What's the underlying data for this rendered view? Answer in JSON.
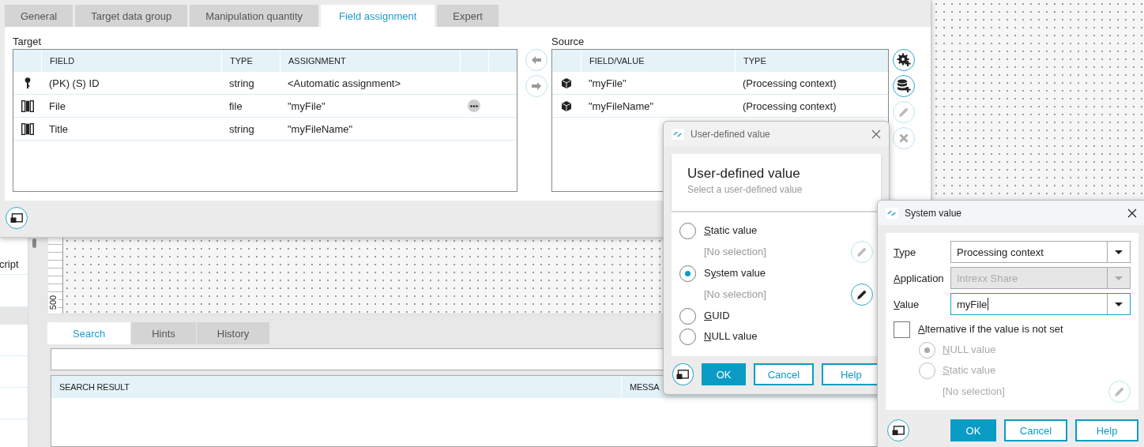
{
  "background": {
    "sidebar_items": [
      {
        "label": "cript"
      }
    ],
    "ruler_label": "500",
    "tabs": [
      {
        "label": "Search",
        "selected": true
      },
      {
        "label": "Hints",
        "selected": false
      },
      {
        "label": "History",
        "selected": false
      }
    ],
    "result_columns": [
      "SEARCH RESULT",
      "MESSA"
    ]
  },
  "window": {
    "tabs": [
      {
        "label": "General",
        "selected": false
      },
      {
        "label": "Target data group",
        "selected": false
      },
      {
        "label": "Manipulation quantity",
        "selected": false
      },
      {
        "label": "Field assignment",
        "selected": true
      },
      {
        "label": "Expert",
        "selected": false
      }
    ],
    "target": {
      "title": "Target",
      "columns": [
        "FIELD",
        "TYPE",
        "ASSIGNMENT"
      ],
      "rows": [
        {
          "kind": "key",
          "field": "(PK) (S) ID",
          "type": "string",
          "assignment": "<Automatic assignment>",
          "has_options": false
        },
        {
          "kind": "field",
          "field": "File",
          "type": "file",
          "assignment": "\"myFile\"",
          "has_options": true
        },
        {
          "kind": "field",
          "field": "Title",
          "type": "string",
          "assignment": "\"myFileName\"",
          "has_options": false
        }
      ]
    },
    "transfer_buttons": [
      {
        "kind": "left",
        "disabled": true
      },
      {
        "kind": "right",
        "disabled": true
      }
    ],
    "source": {
      "title": "Source",
      "columns": [
        "FIELD/VALUE",
        "TYPE"
      ],
      "rows": [
        {
          "value": "\"myFile\"",
          "type": "(Processing context)"
        },
        {
          "value": "\"myFileName\"",
          "type": "(Processing context)"
        }
      ]
    },
    "actions": [
      {
        "kind": "add-gear",
        "disabled": false
      },
      {
        "kind": "add-database",
        "disabled": false
      },
      {
        "kind": "edit",
        "disabled": true
      },
      {
        "kind": "delete",
        "disabled": true
      }
    ]
  },
  "user_defined_dialog": {
    "title": "User-defined value",
    "heading": "User-defined value",
    "subtitle": "Select a user-defined value",
    "options": [
      {
        "label": {
          "key": "S",
          "after": "tatic value"
        },
        "selected": false,
        "value": "[No selection]",
        "edit_disabled": true
      },
      {
        "label": {
          "before": "S",
          "key": "y",
          "after": "stem value"
        },
        "selected": true,
        "value": "[No selection]",
        "edit_disabled": false
      },
      {
        "label": {
          "key": "G",
          "after": "UID"
        },
        "selected": false
      },
      {
        "label": {
          "key": "N",
          "after": "ULL value"
        },
        "selected": false
      }
    ],
    "buttons": [
      {
        "label": "OK",
        "kind": "primary"
      },
      {
        "label": "Cancel",
        "kind": "secondary"
      },
      {
        "label": "Help",
        "kind": "secondary"
      }
    ]
  },
  "system_value_dialog": {
    "title": "System value",
    "fields": [
      {
        "label": {
          "key": "T",
          "after": "ype"
        },
        "value": "Processing context",
        "disabled": false,
        "focused": false
      },
      {
        "label": {
          "key": "A",
          "after": "pplication"
        },
        "value": "Intrexx Share",
        "disabled": true,
        "focused": false
      },
      {
        "label": {
          "key": "V",
          "after": "alue"
        },
        "value": "myFile",
        "disabled": false,
        "focused": true
      }
    ],
    "alternative": {
      "label": {
        "key": "A",
        "after": "lternative if the value is not set"
      },
      "checked": false,
      "options": [
        {
          "label": {
            "key": "N",
            "after": "ULL value"
          },
          "selected": true
        },
        {
          "label": {
            "key": "S",
            "after": "tatic value"
          },
          "selected": false
        }
      ],
      "value": "[No selection]"
    },
    "buttons": [
      {
        "label": "OK",
        "kind": "primary"
      },
      {
        "label": "Cancel",
        "kind": "secondary"
      },
      {
        "label": "Help",
        "kind": "secondary"
      }
    ]
  }
}
